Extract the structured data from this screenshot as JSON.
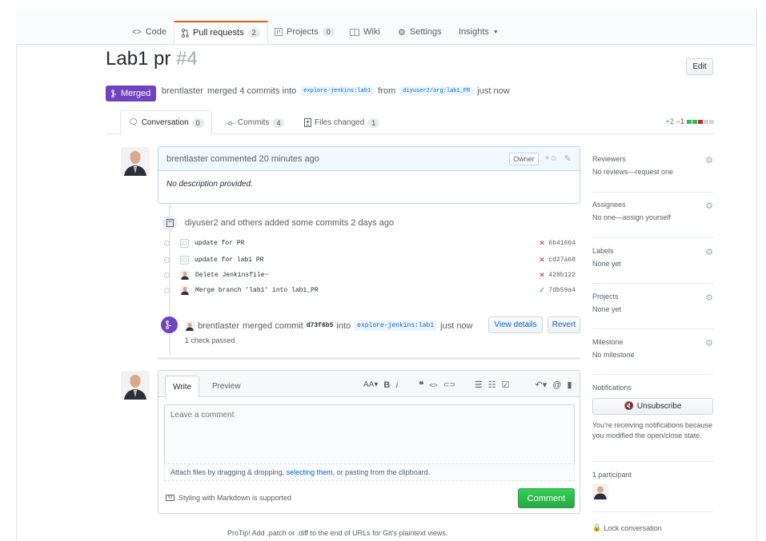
{
  "repo_nav": {
    "code": "Code",
    "pull_requests": "Pull requests",
    "pull_requests_count": "2",
    "projects": "Projects",
    "projects_count": "0",
    "wiki": "Wiki",
    "settings": "Settings",
    "insights": "Insights"
  },
  "pr": {
    "title": "Lab1 pr",
    "number": "#4",
    "edit_label": "Edit",
    "state": "Merged",
    "author": "brentlaster",
    "merged_text": "merged 4 commits into",
    "base_ref": "explore-jenkins:lab1",
    "from_text": "from",
    "head_ref": "diyuser2/org:lab1_PR",
    "time": "just now"
  },
  "pr_tabs": {
    "conversation": "Conversation",
    "conversation_count": "0",
    "commits": "Commits",
    "commits_count": "4",
    "files_changed": "Files changed",
    "files_count": "1",
    "additions": "+2",
    "deletions": "−1"
  },
  "comment": {
    "author": "brentlaster",
    "action": "commented",
    "time": "20 minutes ago",
    "badge": "Owner",
    "body": "No description provided."
  },
  "commits_event": {
    "text": "diyuser2 and others added some commits 2 days ago",
    "commits": [
      {
        "message": "update for PR",
        "sha": "6b41664",
        "status": "fail"
      },
      {
        "message": "update for lab1 PR",
        "sha": "cd27a68",
        "status": "fail"
      },
      {
        "message": "Delete Jenkinsfile~",
        "sha": "428b122",
        "status": "fail"
      },
      {
        "message": "Merge branch 'lab1' into lab1_PR",
        "sha": "7db59a4",
        "status": "ok"
      }
    ]
  },
  "merge_event": {
    "author": "brentlaster",
    "text": "merged commit",
    "sha": "d73f6b5",
    "into": "into",
    "ref": "explore-jenkins:lab1",
    "time": "just now",
    "checks": "1 check passed",
    "view_details": "View details",
    "revert": "Revert"
  },
  "composer": {
    "write_tab": "Write",
    "preview_tab": "Preview",
    "placeholder": "Leave a comment",
    "attach_pre": "Attach files by dragging & dropping,",
    "attach_link": "selecting them",
    "attach_post": ", or pasting from the clipboard.",
    "markdown_note": "Styling with Markdown is supported",
    "submit": "Comment",
    "footer_cut": "ProTip! Add .patch or .diff to the end of URLs for Git's plaintext views."
  },
  "sidebar": {
    "reviewers_h": "Reviewers",
    "reviewers_v": "No reviews—request one",
    "assignees_h": "Assignees",
    "assignees_v": "No one—assign yourself",
    "labels_h": "Labels",
    "labels_v": "None yet",
    "projects_h": "Projects",
    "projects_v": "None yet",
    "milestone_h": "Milestone",
    "milestone_v": "No milestone",
    "notifications_h": "Notifications",
    "unsubscribe": "Unsubscribe",
    "notif_reason": "You're receiving notifications because you modified the open/close state.",
    "participants": "1 participant",
    "lock": "Lock conversation"
  },
  "colors": {
    "merged": "#6f42c1",
    "link": "#0366d6",
    "success": "#28a745",
    "danger": "#cb2431",
    "accent_tab": "#e36209"
  }
}
